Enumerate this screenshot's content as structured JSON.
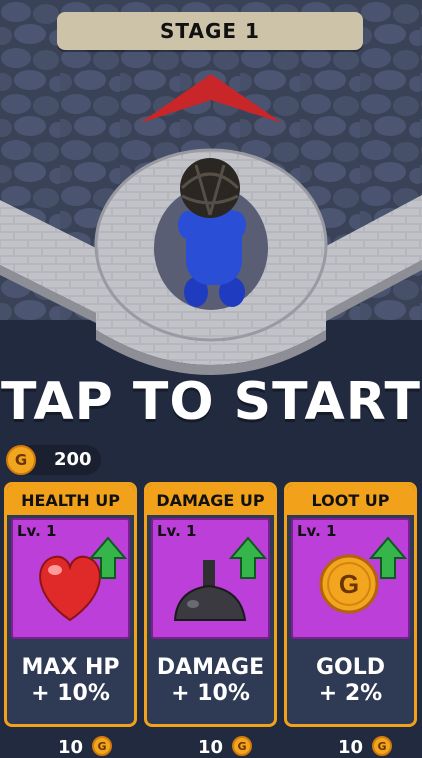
{
  "stage": {
    "label": "STAGE 1"
  },
  "prompt": {
    "text": "TAP TO START"
  },
  "currency": {
    "coin_letter": "G",
    "amount": "200"
  },
  "upgrades": [
    {
      "header": "HEALTH UP",
      "level": "Lv. 1",
      "stat_name": "MAX HP",
      "stat_bonus": "+ 10%",
      "price": "10",
      "icon": "heart-icon"
    },
    {
      "header": "DAMAGE UP",
      "level": "Lv. 1",
      "stat_name": "DAMAGE",
      "stat_bonus": "+ 10%",
      "price": "10",
      "icon": "bomb-icon"
    },
    {
      "header": "LOOT UP",
      "level": "Lv. 1",
      "stat_name": "GOLD",
      "stat_bonus": "+ 2%",
      "price": "10",
      "icon": "gold-coin-icon"
    }
  ],
  "colors": {
    "card_border": "#f2a11b",
    "card_icon_bg": "#bb3fd8",
    "card_body": "#2f3a55",
    "upgrade_arrow": "#35b54a",
    "player": "#2a4fd6"
  }
}
